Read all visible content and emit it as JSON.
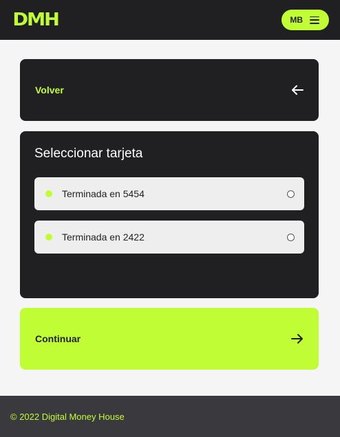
{
  "header": {
    "logo_text": "DMH",
    "user_initials": "MB",
    "brand_color": "#c1fd35",
    "menu_icon": "hamburger-icon"
  },
  "back": {
    "label": "Volver",
    "icon": "arrow-left-icon"
  },
  "select": {
    "title": "Seleccionar tarjeta",
    "cards": [
      {
        "label": "Terminada en 5454",
        "selected": false
      },
      {
        "label": "Terminada en 2422",
        "selected": false
      }
    ]
  },
  "continue": {
    "label": "Continuar",
    "icon": "arrow-right-icon"
  },
  "footer": {
    "text": "© 2022 Digital Money House"
  }
}
